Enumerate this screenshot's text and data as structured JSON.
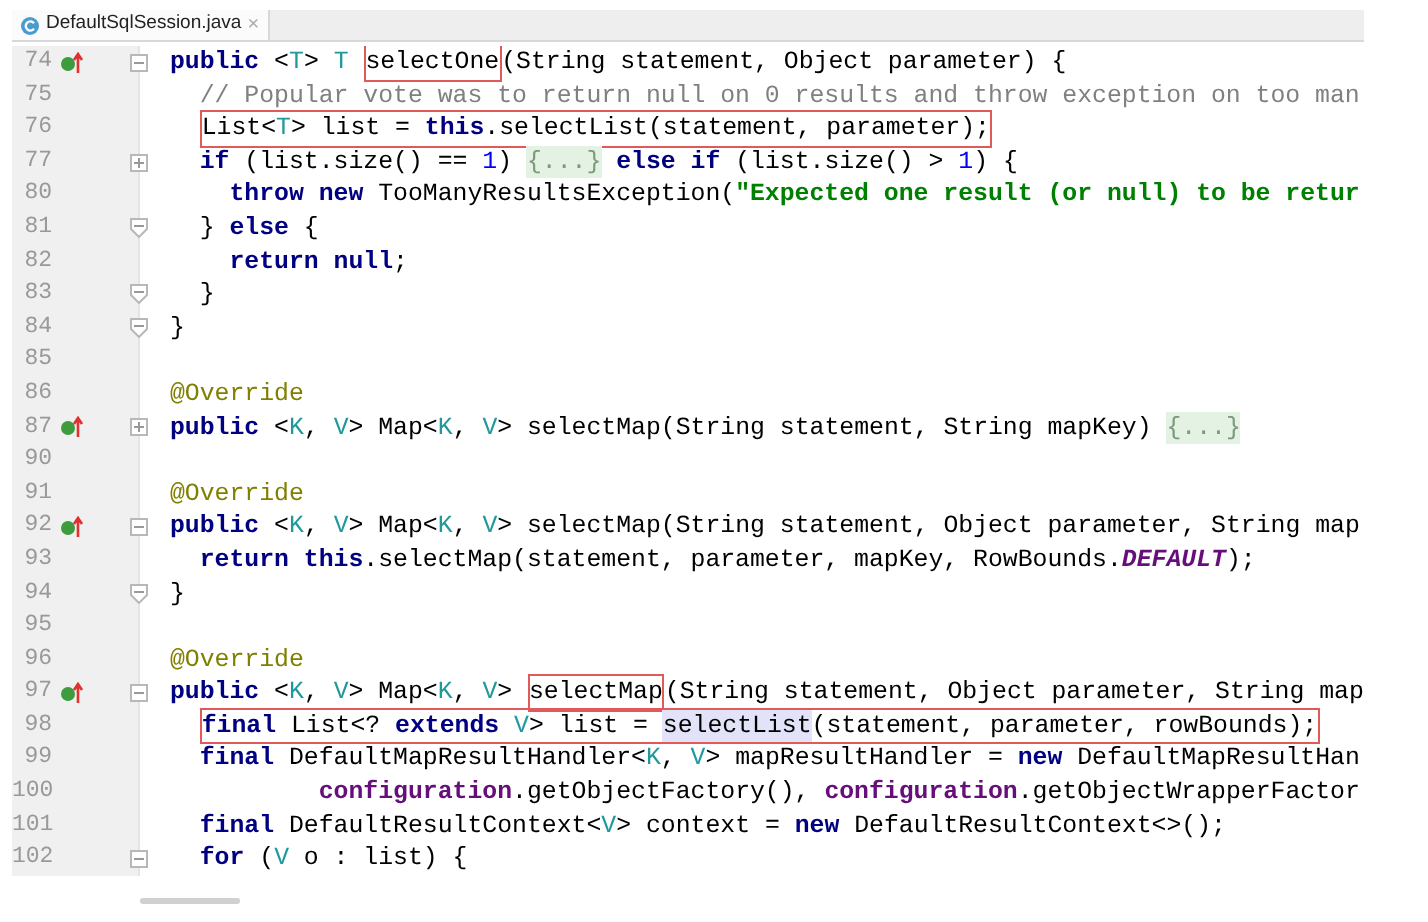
{
  "tab": {
    "label": "DefaultSqlSession.java",
    "close": "×",
    "selected": true
  },
  "lines": [
    {
      "number": "74",
      "override_marker": true,
      "fold": {
        "kind": "start"
      },
      "segments": [
        {
          "kind": "text",
          "tokens": [
            {
              "kind": "keyword",
              "text": "public"
            },
            {
              "kind": "plain",
              "text": " <"
            },
            {
              "kind": "type",
              "text": "T"
            },
            {
              "kind": "plain",
              "text": "> "
            },
            {
              "kind": "type",
              "text": "T "
            }
          ]
        },
        {
          "kind": "box",
          "segments": [
            {
              "kind": "text",
              "tokens": [
                {
                  "kind": "plain",
                  "text": "selectOne"
                }
              ]
            }
          ]
        },
        {
          "kind": "text",
          "tokens": [
            {
              "kind": "plain",
              "text": "(String statement, Object parameter) {"
            }
          ]
        }
      ]
    },
    {
      "number": "75",
      "override_marker": false,
      "segments": [
        {
          "kind": "text",
          "tokens": [
            {
              "kind": "comment",
              "text": "  // Popular vote was to return null on 0 results and throw exception on too man"
            }
          ]
        }
      ]
    },
    {
      "number": "76",
      "override_marker": false,
      "segments": [
        {
          "kind": "indent"
        },
        {
          "kind": "box",
          "segments": [
            {
              "kind": "text",
              "tokens": [
                {
                  "kind": "plain",
                  "text": "List<"
                },
                {
                  "kind": "type",
                  "text": "T"
                },
                {
                  "kind": "plain",
                  "text": "> list = "
                },
                {
                  "kind": "keyword",
                  "text": "this"
                },
                {
                  "kind": "plain",
                  "text": ".selectList(statement, parameter);"
                }
              ]
            }
          ]
        }
      ]
    },
    {
      "number": "77",
      "override_marker": false,
      "fold": {
        "kind": "collapsed"
      },
      "segments": [
        {
          "kind": "text",
          "tokens": [
            {
              "kind": "keyword",
              "text": "  if"
            },
            {
              "kind": "plain",
              "text": " (list.size() == "
            },
            {
              "kind": "number",
              "text": "1"
            },
            {
              "kind": "plain",
              "text": ") "
            }
          ]
        },
        {
          "kind": "folded",
          "text": "{...}"
        },
        {
          "kind": "text",
          "tokens": [
            {
              "kind": "keyword",
              "text": " else if"
            },
            {
              "kind": "plain",
              "text": " (list.size() > "
            },
            {
              "kind": "number",
              "text": "1"
            },
            {
              "kind": "plain",
              "text": ") {"
            }
          ]
        }
      ]
    },
    {
      "number": "80",
      "override_marker": false,
      "segments": [
        {
          "kind": "text",
          "tokens": [
            {
              "kind": "keyword",
              "text": "    throw new"
            },
            {
              "kind": "plain",
              "text": " TooManyResultsException("
            },
            {
              "kind": "string",
              "text": "\"Expected one result (or null) to be retur"
            }
          ]
        }
      ]
    },
    {
      "number": "81",
      "override_marker": false,
      "fold": {
        "kind": "end"
      },
      "segments": [
        {
          "kind": "text",
          "tokens": [
            {
              "kind": "plain",
              "text": "  } "
            },
            {
              "kind": "keyword",
              "text": "else"
            },
            {
              "kind": "plain",
              "text": " {"
            }
          ]
        }
      ]
    },
    {
      "number": "82",
      "override_marker": false,
      "segments": [
        {
          "kind": "text",
          "tokens": [
            {
              "kind": "keyword",
              "text": "    return null"
            },
            {
              "kind": "plain",
              "text": ";"
            }
          ]
        }
      ]
    },
    {
      "number": "83",
      "override_marker": false,
      "fold": {
        "kind": "end"
      },
      "segments": [
        {
          "kind": "text",
          "tokens": [
            {
              "kind": "plain",
              "text": "  }"
            }
          ]
        }
      ]
    },
    {
      "number": "84",
      "override_marker": false,
      "fold": {
        "kind": "end"
      },
      "segments": [
        {
          "kind": "text",
          "tokens": [
            {
              "kind": "plain",
              "text": "}"
            }
          ]
        }
      ]
    },
    {
      "number": "85",
      "override_marker": false
    },
    {
      "number": "86",
      "override_marker": false,
      "segments": [
        {
          "kind": "text",
          "tokens": [
            {
              "kind": "annotation",
              "text": "@Override"
            }
          ]
        }
      ]
    },
    {
      "number": "87",
      "override_marker": true,
      "fold": {
        "kind": "collapsed"
      },
      "segments": [
        {
          "kind": "text",
          "tokens": [
            {
              "kind": "keyword",
              "text": "public"
            },
            {
              "kind": "plain",
              "text": " <"
            },
            {
              "kind": "type",
              "text": "K"
            },
            {
              "kind": "plain",
              "text": ", "
            },
            {
              "kind": "type",
              "text": "V"
            },
            {
              "kind": "plain",
              "text": "> Map<"
            },
            {
              "kind": "type",
              "text": "K"
            },
            {
              "kind": "plain",
              "text": ", "
            },
            {
              "kind": "type",
              "text": "V"
            },
            {
              "kind": "plain",
              "text": "> selectMap(String statement, String mapKey) "
            }
          ]
        },
        {
          "kind": "folded",
          "text": "{...}"
        }
      ]
    },
    {
      "number": "90",
      "override_marker": false
    },
    {
      "number": "91",
      "override_marker": false,
      "segments": [
        {
          "kind": "text",
          "tokens": [
            {
              "kind": "annotation",
              "text": "@Override"
            }
          ]
        }
      ]
    },
    {
      "number": "92",
      "override_marker": true,
      "fold": {
        "kind": "start"
      },
      "segments": [
        {
          "kind": "text",
          "tokens": [
            {
              "kind": "keyword",
              "text": "public"
            },
            {
              "kind": "plain",
              "text": " <"
            },
            {
              "kind": "type",
              "text": "K"
            },
            {
              "kind": "plain",
              "text": ", "
            },
            {
              "kind": "type",
              "text": "V"
            },
            {
              "kind": "plain",
              "text": "> Map<"
            },
            {
              "kind": "type",
              "text": "K"
            },
            {
              "kind": "plain",
              "text": ", "
            },
            {
              "kind": "type",
              "text": "V"
            },
            {
              "kind": "plain",
              "text": "> selectMap(String statement, Object parameter, String map"
            }
          ]
        }
      ]
    },
    {
      "number": "93",
      "override_marker": false,
      "segments": [
        {
          "kind": "text",
          "tokens": [
            {
              "kind": "keyword",
              "text": "  return this"
            },
            {
              "kind": "plain",
              "text": ".selectMap(statement, parameter, mapKey, RowBounds."
            },
            {
              "kind": "constant",
              "text": "DEFAULT"
            },
            {
              "kind": "plain",
              "text": ");"
            }
          ]
        }
      ]
    },
    {
      "number": "94",
      "override_marker": false,
      "fold": {
        "kind": "end"
      },
      "segments": [
        {
          "kind": "text",
          "tokens": [
            {
              "kind": "plain",
              "text": "}"
            }
          ]
        }
      ]
    },
    {
      "number": "95",
      "override_marker": false
    },
    {
      "number": "96",
      "override_marker": false,
      "segments": [
        {
          "kind": "text",
          "tokens": [
            {
              "kind": "annotation",
              "text": "@Override"
            }
          ]
        }
      ]
    },
    {
      "number": "97",
      "override_marker": true,
      "fold": {
        "kind": "start"
      },
      "segments": [
        {
          "kind": "text",
          "tokens": [
            {
              "kind": "keyword",
              "text": "public"
            },
            {
              "kind": "plain",
              "text": " <"
            },
            {
              "kind": "type",
              "text": "K"
            },
            {
              "kind": "plain",
              "text": ", "
            },
            {
              "kind": "type",
              "text": "V"
            },
            {
              "kind": "plain",
              "text": "> Map<"
            },
            {
              "kind": "type",
              "text": "K"
            },
            {
              "kind": "plain",
              "text": ", "
            },
            {
              "kind": "type",
              "text": "V"
            },
            {
              "kind": "plain",
              "text": "> "
            }
          ]
        },
        {
          "kind": "box",
          "segments": [
            {
              "kind": "text",
              "tokens": [
                {
                  "kind": "plain",
                  "text": "selectMap"
                }
              ]
            }
          ]
        },
        {
          "kind": "text",
          "tokens": [
            {
              "kind": "plain",
              "text": "(String statement, Object parameter, String map"
            }
          ]
        }
      ]
    },
    {
      "number": "98",
      "override_marker": false,
      "segments": [
        {
          "kind": "indent"
        },
        {
          "kind": "box",
          "segments": [
            {
              "kind": "text",
              "tokens": [
                {
                  "kind": "keyword",
                  "text": "final"
                },
                {
                  "kind": "plain",
                  "text": " List<? "
                },
                {
                  "kind": "keyword",
                  "text": "extends "
                },
                {
                  "kind": "type",
                  "text": "V"
                },
                {
                  "kind": "plain",
                  "text": "> list = "
                }
              ]
            },
            {
              "kind": "usage",
              "tokens": [
                {
                  "kind": "plain",
                  "text": "selectList"
                }
              ]
            },
            {
              "kind": "text",
              "tokens": [
                {
                  "kind": "plain",
                  "text": "(statement, parameter, rowBounds);"
                }
              ]
            }
          ]
        }
      ]
    },
    {
      "number": "99",
      "override_marker": false,
      "segments": [
        {
          "kind": "text",
          "tokens": [
            {
              "kind": "keyword",
              "text": "  final"
            },
            {
              "kind": "plain",
              "text": " DefaultMapResultHandler<"
            },
            {
              "kind": "type",
              "text": "K"
            },
            {
              "kind": "plain",
              "text": ", "
            },
            {
              "kind": "type",
              "text": "V"
            },
            {
              "kind": "plain",
              "text": "> mapResultHandler = "
            },
            {
              "kind": "keyword",
              "text": "new"
            },
            {
              "kind": "plain",
              "text": " DefaultMapResultHan"
            }
          ]
        }
      ]
    },
    {
      "number": "100",
      "override_marker": false,
      "segments": [
        {
          "kind": "text",
          "tokens": [
            {
              "kind": "field",
              "text": "          configuration"
            },
            {
              "kind": "plain",
              "text": ".getObjectFactory(), "
            },
            {
              "kind": "field",
              "text": "configuration"
            },
            {
              "kind": "plain",
              "text": ".getObjectWrapperFactor"
            }
          ]
        }
      ]
    },
    {
      "number": "101",
      "override_marker": false,
      "segments": [
        {
          "kind": "text",
          "tokens": [
            {
              "kind": "keyword",
              "text": "  final"
            },
            {
              "kind": "plain",
              "text": " DefaultResultContext<"
            },
            {
              "kind": "type",
              "text": "V"
            },
            {
              "kind": "plain",
              "text": "> context = "
            },
            {
              "kind": "keyword",
              "text": "new"
            },
            {
              "kind": "plain",
              "text": " DefaultResultContext<>();"
            }
          ]
        }
      ]
    },
    {
      "number": "102",
      "override_marker": false,
      "fold": {
        "kind": "start"
      },
      "segments": [
        {
          "kind": "text",
          "tokens": [
            {
              "kind": "keyword",
              "text": "  for"
            },
            {
              "kind": "plain",
              "text": " ("
            },
            {
              "kind": "type",
              "text": "V"
            },
            {
              "kind": "plain",
              "text": " o : list) {"
            }
          ]
        }
      ]
    }
  ]
}
